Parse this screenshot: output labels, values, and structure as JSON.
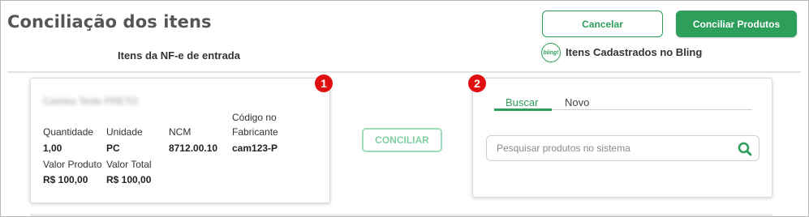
{
  "header": {
    "title": "Conciliação dos itens",
    "cancel_label": "Cancelar",
    "reconcile_label": "Conciliar Produtos"
  },
  "left_panel": {
    "heading": "Itens da NF-e de entrada",
    "badge": "1",
    "product_name": "Camisa Teste PRETO",
    "fields": {
      "quantity_label": "Quantidade",
      "quantity_value": "1,00",
      "unit_label": "Unidade",
      "unit_value": "PC",
      "ncm_label": "NCM",
      "ncm_value": "8712.00.10",
      "mfr_code_label_line1": "Código no",
      "mfr_code_label_line2": "Fabricante",
      "mfr_code_value": "cam123-P",
      "unit_price_label": "Valor Produto",
      "unit_price_value": "R$ 100,00",
      "total_label": "Valor Total",
      "total_value": "R$ 100,00"
    }
  },
  "middle": {
    "conciliar_label": "CONCILIAR"
  },
  "right_panel": {
    "logo_text": "bling!",
    "heading": "Itens Cadastrados no Bling",
    "badge": "2",
    "tabs": [
      {
        "label": "Buscar",
        "active": true
      },
      {
        "label": "Novo",
        "active": false
      }
    ],
    "search": {
      "placeholder": "Pesquisar produtos no sistema",
      "value": ""
    }
  },
  "colors": {
    "accent": "#2e9e5b",
    "badge": "#e01010",
    "title": "#555555"
  }
}
